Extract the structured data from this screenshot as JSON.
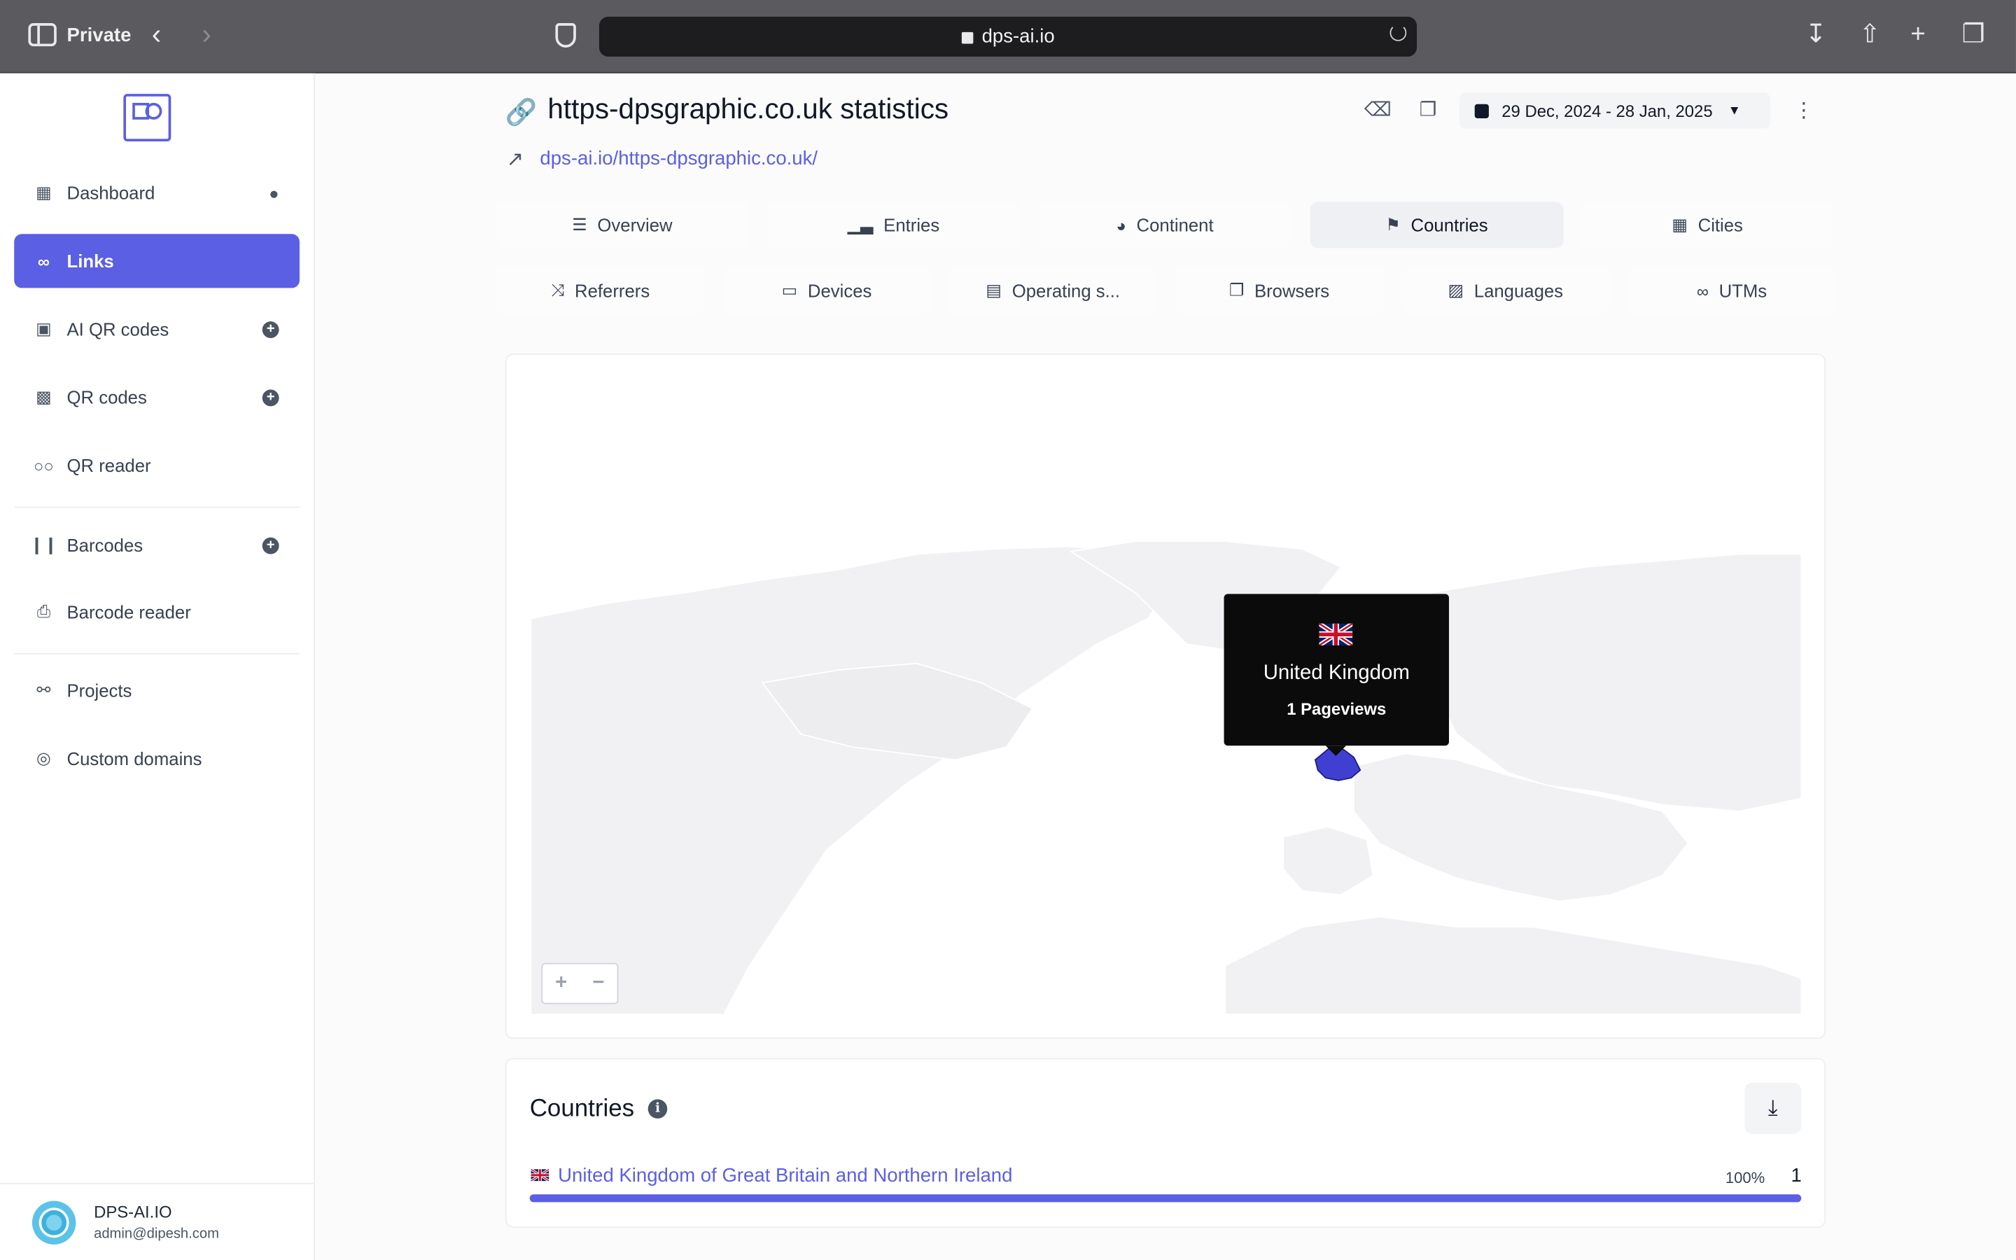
{
  "browser": {
    "mode_label": "Private",
    "address": "dps-ai.io"
  },
  "sidebar": {
    "items": [
      {
        "label": "Dashboard",
        "icon": "table-icon"
      },
      {
        "label": "Links",
        "icon": "link-icon"
      },
      {
        "label": "AI QR codes",
        "icon": "robot-icon"
      },
      {
        "label": "QR codes",
        "icon": "qrcode-icon"
      },
      {
        "label": "QR reader",
        "icon": "glasses-icon"
      },
      {
        "label": "Barcodes",
        "icon": "barcode-icon"
      },
      {
        "label": "Barcode reader",
        "icon": "print-icon"
      },
      {
        "label": "Projects",
        "icon": "project-diagram-icon"
      },
      {
        "label": "Custom domains",
        "icon": "globe-icon"
      }
    ],
    "user": {
      "name": "DPS-AI.IO",
      "email": "admin@dipesh.com"
    }
  },
  "header": {
    "title": "https-dpsgraphic.co.uk statistics",
    "link": "dps-ai.io/https-dpsgraphic.co.uk/",
    "date_range": "29 Dec, 2024 - 28 Jan, 2025"
  },
  "tabs_row1": [
    {
      "label": "Overview",
      "icon": "list-icon"
    },
    {
      "label": "Entries",
      "icon": "chart-bar-icon"
    },
    {
      "label": "Continent",
      "icon": "globe-africa-icon"
    },
    {
      "label": "Countries",
      "icon": "flag-icon"
    },
    {
      "label": "Cities",
      "icon": "city-icon"
    }
  ],
  "tabs_row2": [
    {
      "label": "Referrers",
      "icon": "random-icon"
    },
    {
      "label": "Devices",
      "icon": "laptop-icon"
    },
    {
      "label": "Operating s...",
      "icon": "server-icon"
    },
    {
      "label": "Browsers",
      "icon": "window-icon"
    },
    {
      "label": "Languages",
      "icon": "language-icon"
    },
    {
      "label": "UTMs",
      "icon": "link-icon"
    }
  ],
  "active_tab": "Countries",
  "map": {
    "tooltip": {
      "country": "United Kingdom",
      "pageviews": "1 Pageviews"
    },
    "highlight_color": "#3f3fd1",
    "land_color": "#f3f3f4"
  },
  "countries": {
    "title": "Countries",
    "rows": [
      {
        "name": "United Kingdom of Great Britain and Northern Ireland",
        "percent": "100%",
        "count": "1",
        "fill": 1.0
      }
    ]
  },
  "colors": {
    "accent": "#5b5fe3"
  }
}
